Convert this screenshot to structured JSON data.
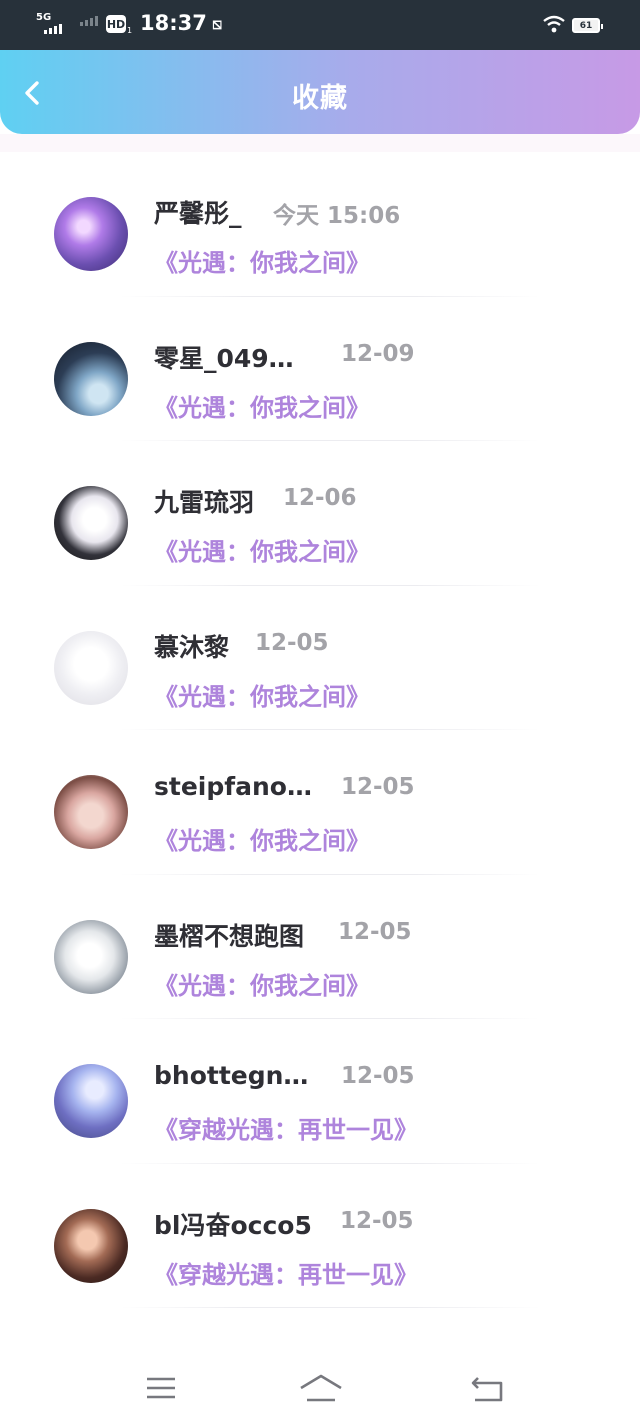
{
  "status_bar": {
    "network": "5G",
    "hd": "HD",
    "hd_sub": "1",
    "time": "18:37",
    "battery": "61"
  },
  "header": {
    "title": "收藏",
    "back_icon": "chevron-left-icon"
  },
  "items": [
    {
      "name": "严馨彤_",
      "time": "今天 15:06",
      "title": "《光遇：你我之间》"
    },
    {
      "name": "零星_049…",
      "time": "12-09",
      "title": "《光遇：你我之间》"
    },
    {
      "name": "九雷琉羽",
      "time": "12-06",
      "title": "《光遇：你我之间》"
    },
    {
      "name": "慕沐黎",
      "time": "12-05",
      "title": "《光遇：你我之间》"
    },
    {
      "name": "steipfano…",
      "time": "12-05",
      "title": "《光遇：你我之间》"
    },
    {
      "name": "墨槢不想跑图",
      "time": "12-05",
      "title": "《光遇：你我之间》"
    },
    {
      "name": "bhottegn…",
      "time": "12-05",
      "title": "《穿越光遇：再世一见》"
    },
    {
      "name": "bl冯奋occo5",
      "time": "12-05",
      "title": "《穿越光遇：再世一见》"
    }
  ],
  "nav": {
    "menu_icon": "menu-icon",
    "home_icon": "home-icon",
    "back_icon": "back-icon"
  },
  "colors": {
    "accent_purple": "#ae84dc",
    "header_gradient_start": "#5fd0f2",
    "header_gradient_end": "#c79ae6"
  }
}
